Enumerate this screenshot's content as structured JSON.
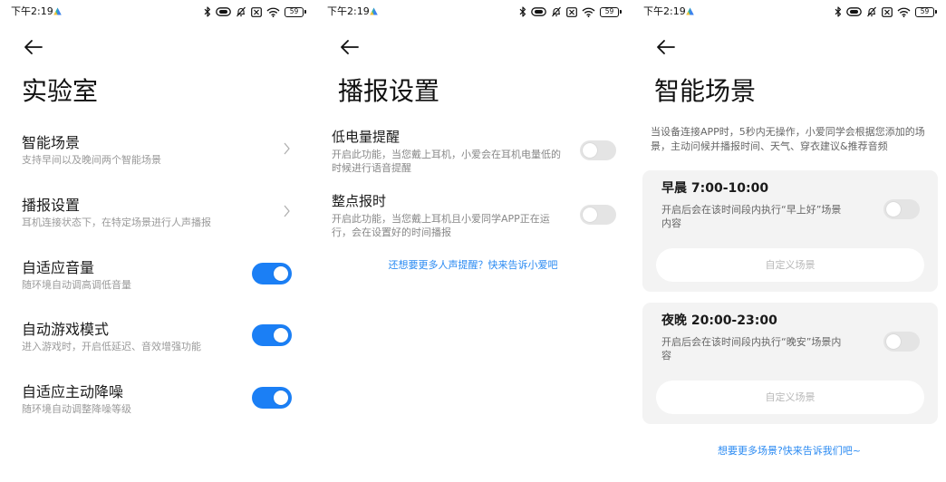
{
  "status_bar": {
    "time": "下午2:19",
    "battery": "59",
    "icons": [
      "notification-app-icon",
      "bluetooth-icon",
      "headset-icon",
      "bell-off-icon",
      "no-sim-icon",
      "wifi-icon",
      "battery-icon"
    ]
  },
  "colors": {
    "accent": "#1b7ff5",
    "link": "#2a8af2",
    "card_bg": "#f3f3f3",
    "toggle_off": "#e4e4e4"
  },
  "back_icon": "arrow-left-icon",
  "lab": {
    "title": "实验室",
    "items": [
      {
        "title": "智能场景",
        "subtitle": "支持早间以及晚间两个智能场景",
        "trailing_icon": "chevron-right-icon"
      },
      {
        "title": "播报设置",
        "subtitle": "耳机连接状态下，在特定场景进行人声播报",
        "trailing_icon": "chevron-right-icon"
      },
      {
        "title": "自适应音量",
        "subtitle": "随环境自动调高调低音量",
        "on": true
      },
      {
        "title": "自动游戏模式",
        "subtitle": "进入游戏时，开启低延迟、音效增强功能",
        "on": true
      },
      {
        "title": "自适应主动降噪",
        "subtitle": "随环境自动调整降噪等级",
        "on": true
      }
    ]
  },
  "broadcast": {
    "title": "播报设置",
    "items": [
      {
        "title": "低电量提醒",
        "desc_lines": [
          "开启此功能，当您戴上耳机，小爱会在耳机电量低的",
          "时候进行语音提醒"
        ],
        "on": false
      },
      {
        "title": "整点报时",
        "desc_lines": [
          "开启此功能，当您戴上耳机且小爱同学APP正在运",
          "行，会在设置好的时间播报"
        ],
        "on": false
      }
    ],
    "feedback_link": "还想要更多人声提醒？快来告诉小爱吧"
  },
  "scenes": {
    "title": "智能场景",
    "intro_lines": [
      "当设备连接APP时，5秒内无操作，小爱同学会根据您添加的场",
      "景，主动问候并播报时间、天气、穿衣建议&推荐音频"
    ],
    "cards": [
      {
        "title": "早晨 7:00-10:00",
        "desc_lines": [
          "开启后会在该时间段内执行“早上好”场景",
          "内容"
        ],
        "on": false,
        "button": "自定义场景"
      },
      {
        "title": "夜晚 20:00-23:00",
        "desc_lines": [
          "开启后会在该时间段内执行“晚安”场景内",
          "容"
        ],
        "on": false,
        "button": "自定义场景"
      }
    ],
    "feedback_link": "想要更多场景?快来告诉我们吧~"
  }
}
